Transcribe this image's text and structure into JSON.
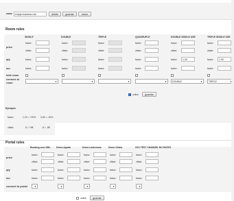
{
  "top": {
    "name_label": "name",
    "name_value": "empty business rule",
    "delete_label": "delete",
    "save_label": "guardar",
    "back_label": "volver"
  },
  "room_rules": {
    "title": "Room rules",
    "columns": [
      "SINGLE",
      "DOUBLE",
      "TRIPLE",
      "QUADRUPLE",
      "DOUBLE SINGLE USE",
      "TRIPLE SINGLE USE"
    ],
    "row_labels": {
      "price": "price",
      "qty": "qty",
      "mu": "mu",
      "hide_room": "hide room",
      "connect_to_room": "connect to room"
    },
    "factor_label": "factor:",
    "offset_label": "offset:",
    "qty_values": [
      "",
      "",
      "",
      "",
      "1.00",
      "1.00"
    ],
    "connect_values": [
      "",
      "",
      "",
      "",
      "DOUBLE",
      "TRIPLE"
    ],
    "online_label": "online",
    "save_label": "guardar"
  },
  "example": {
    "title": "Ejemplo",
    "factor_label": "factor:",
    "offset_label": "offset:",
    "factor_a": "1.20",
    "factor_a_pct": "= +20%",
    "factor_b": "0.80",
    "factor_b_pct": "= -20%",
    "offset_a": "8",
    "offset_a_val": "= +8€",
    "offset_b": "-8",
    "offset_b_val": "= -8€"
  },
  "portal_rules": {
    "title": "Portal rules",
    "columns": [
      "Booking.com XML",
      "Demo Agoda",
      "Demo Lastrooms",
      "Demo Orbitz",
      "XXX TEST CHANNEL NO RATES"
    ],
    "row_labels": {
      "price": "price",
      "qty": "qty",
      "mu": "mu",
      "connect": "connect to portal"
    },
    "factor_label": "factor:",
    "offset_label": "offset:",
    "online_label": "online",
    "save_label": "guardar"
  },
  "colors": {
    "checked": "#3a77d8",
    "disabled_input": "#e2e2e2"
  }
}
